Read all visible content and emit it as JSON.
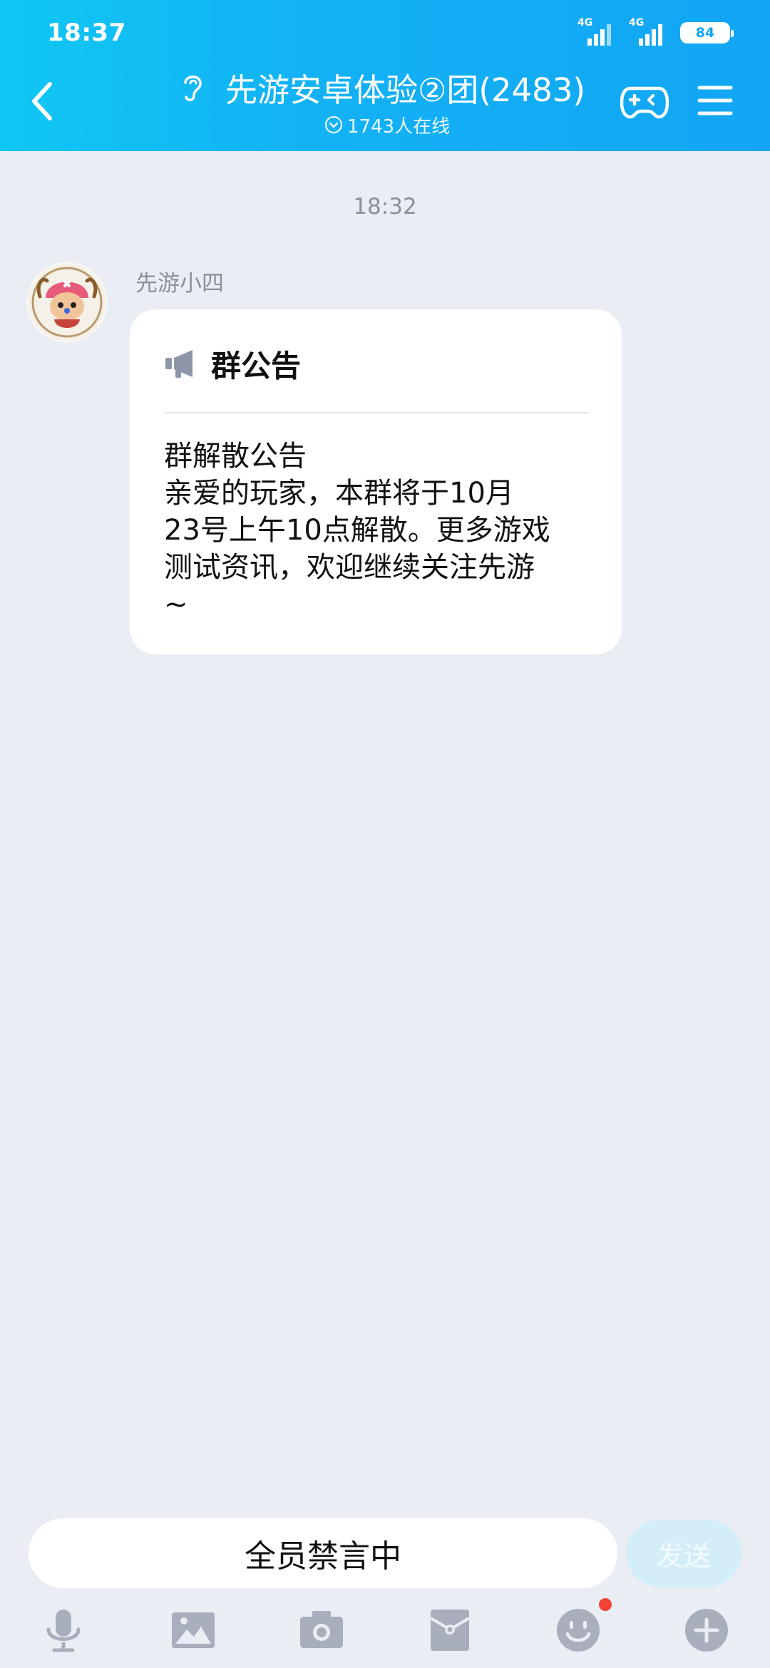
{
  "status_bar": {
    "time": "18:37",
    "signal1_label": "4G",
    "signal2_label": "4G",
    "battery": "84"
  },
  "header": {
    "title": "先游安卓体验②团(2483)",
    "online": "1743人在线",
    "colors": {
      "gradient_start": "#10C7F4",
      "gradient_end": "#12A5F4"
    }
  },
  "chat": {
    "timestamp": "18:32",
    "sender": "先游小四",
    "notice": {
      "heading": "群公告",
      "lines": [
        "群解散公告",
        "亲爱的玩家，本群将于10月",
        "23号上午10点解散。更多游戏",
        "测试资讯，欢迎继续关注先游",
        "~"
      ]
    }
  },
  "input": {
    "placeholder": "全员禁言中",
    "send_label": "发送"
  },
  "toolbar": {
    "items": [
      "microphone-icon",
      "image-icon",
      "camera-icon",
      "red-packet-icon",
      "emoji-icon",
      "plus-icon"
    ]
  }
}
